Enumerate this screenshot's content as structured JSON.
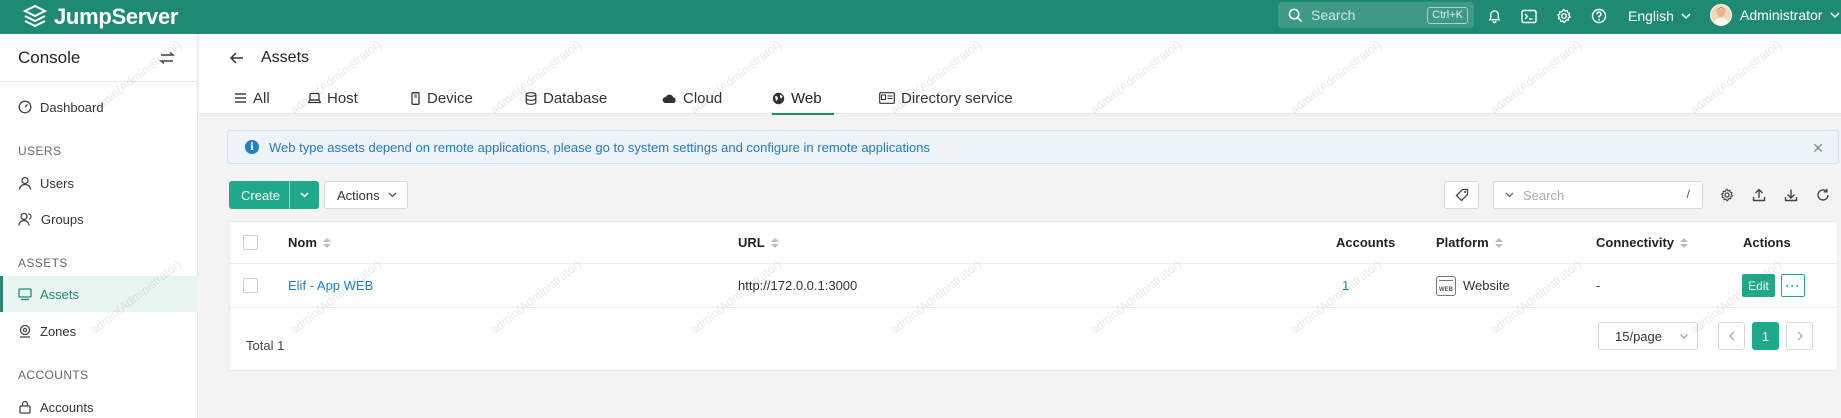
{
  "topbar": {
    "brand": "JumpServer",
    "search_placeholder": "Search",
    "search_shortcut": "Ctrl+K",
    "language": "English",
    "user_name": "Administrator",
    "accent": "#1f8a72"
  },
  "sidebar": {
    "title": "Console",
    "items": [
      {
        "label": "Dashboard",
        "icon": "dashboard-icon"
      },
      {
        "section": "USERS"
      },
      {
        "label": "Users",
        "icon": "user-icon"
      },
      {
        "label": "Groups",
        "icon": "group-icon"
      },
      {
        "section": "ASSETS"
      },
      {
        "label": "Assets",
        "icon": "assets-icon",
        "active": true
      },
      {
        "label": "Zones",
        "icon": "zone-icon"
      },
      {
        "section": "ACCOUNTS"
      },
      {
        "label": "Accounts",
        "icon": "lock-icon"
      }
    ]
  },
  "header": {
    "title": "Assets",
    "tabs": [
      {
        "label": "All",
        "icon": "list-icon"
      },
      {
        "label": "Host",
        "icon": "host-icon"
      },
      {
        "label": "Device",
        "icon": "device-icon"
      },
      {
        "label": "Database",
        "icon": "database-icon"
      },
      {
        "label": "Cloud",
        "icon": "cloud-icon"
      },
      {
        "label": "Web",
        "icon": "web-icon",
        "active": true
      },
      {
        "label": "Directory service",
        "icon": "directory-icon"
      }
    ]
  },
  "banner": {
    "text": "Web type assets depend on remote applications, please go to system settings and configure in remote applications"
  },
  "toolbar": {
    "create_label": "Create",
    "actions_label": "Actions",
    "search_placeholder": "Search",
    "search_hint": "/"
  },
  "table": {
    "columns": [
      "Nom",
      "URL",
      "Accounts",
      "Platform",
      "Connectivity",
      "Actions"
    ],
    "rows": [
      {
        "name": "Elif - App WEB",
        "url": "http://172.0.0.1:3000",
        "accounts": "1",
        "platform": "Website",
        "platform_badge": "WEB",
        "connectivity": "-",
        "edit": "Edit",
        "more": "···"
      }
    ],
    "total": "Total 1",
    "page_size": "15/page",
    "current_page": "1"
  },
  "watermark": "admin(Administrator)"
}
